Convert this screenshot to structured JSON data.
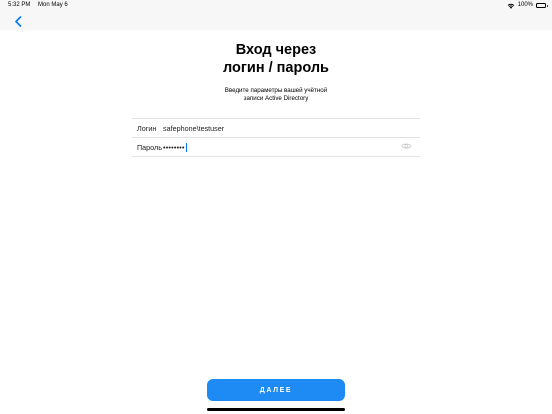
{
  "status_bar": {
    "time": "5:32 PM",
    "date": "Mon May 6",
    "battery": "100%"
  },
  "colors": {
    "accent": "#007aff",
    "button": "#1e8bf5",
    "top_bar": "#f7f7f7"
  },
  "icons": {
    "back": "chevron-left-icon",
    "wifi": "wifi-icon",
    "battery": "battery-icon",
    "password_visibility": "eye-icon"
  },
  "header": {
    "title_line1": "Вход через",
    "title_line2": "логин / пароль",
    "subtitle_line1": "Введите параметры вашей учётной",
    "subtitle_line2": "записи Active Directory"
  },
  "form": {
    "login_label": "Логин",
    "login_value": "safephone\\testuser",
    "password_label": "Пароль",
    "password_masked": "••••••••"
  },
  "actions": {
    "next_label": "ДАЛЕЕ"
  }
}
